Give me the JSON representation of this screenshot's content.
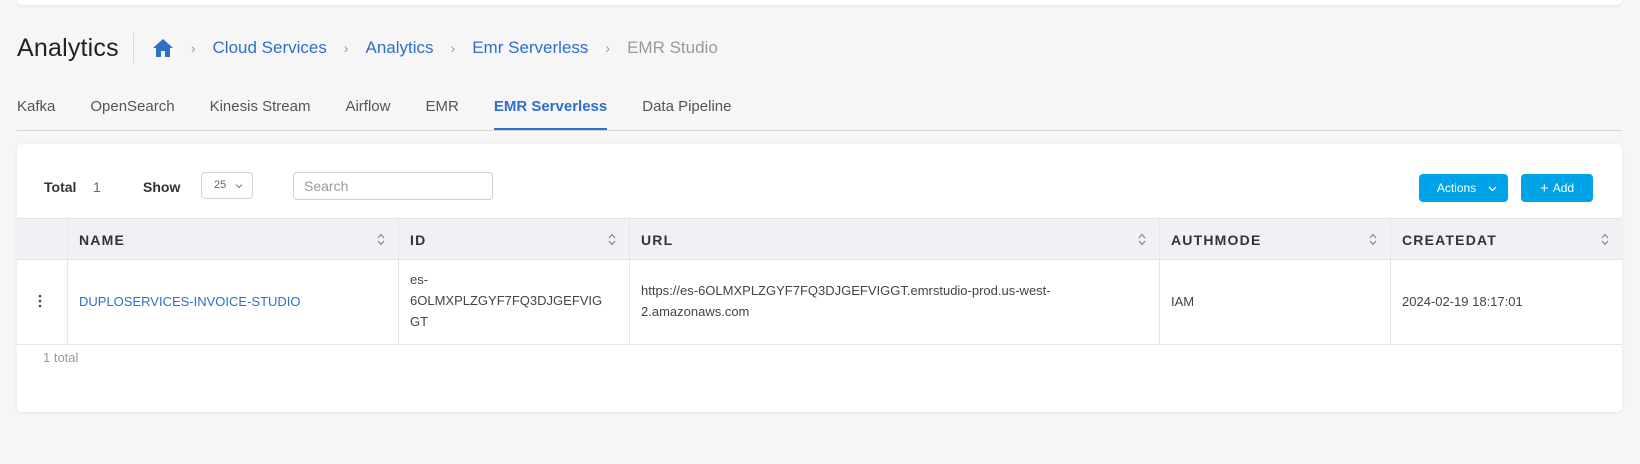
{
  "page": {
    "title": "Analytics"
  },
  "breadcrumb": {
    "items": [
      "Cloud Services",
      "Analytics",
      "Emr Serverless"
    ],
    "current": "EMR Studio"
  },
  "tabs": [
    {
      "label": "Kafka",
      "active": false
    },
    {
      "label": "OpenSearch",
      "active": false
    },
    {
      "label": "Kinesis Stream",
      "active": false
    },
    {
      "label": "Airflow",
      "active": false
    },
    {
      "label": "EMR",
      "active": false
    },
    {
      "label": "EMR Serverless",
      "active": true
    },
    {
      "label": "Data Pipeline",
      "active": false
    }
  ],
  "toolbar": {
    "total_label": "Total",
    "total_value": "1",
    "show_label": "Show",
    "page_size": "25",
    "search_placeholder": "Search",
    "search_value": "",
    "actions_label": "Actions",
    "add_label": "Add"
  },
  "table": {
    "columns": [
      "NAME",
      "ID",
      "URL",
      "AUTHMODE",
      "CREATEDAT"
    ],
    "rows": [
      {
        "name": "DUPLOSERVICES-INVOICE-STUDIO",
        "id_lines": [
          "es-",
          "6OLMXPLZGYF7FQ3DJGEFVIG",
          "GT"
        ],
        "url_lines": [
          "https://es-6OLMXPLZGYF7FQ3DJGEFVIGGT.emrstudio-prod.us-west-",
          "2.amazonaws.com"
        ],
        "authmode": "IAM",
        "createdat": "2024-02-19 18:17:01"
      }
    ],
    "footer": "1 total"
  },
  "colors": {
    "accent": "#2f6fc8",
    "button": "#00a3e8",
    "background": "#f6f6f7"
  },
  "icons": {
    "home": "home-icon",
    "breadcrumb_separator": "chevron-right-icon",
    "sort": "sort-icon",
    "row_menu": "kebab-icon",
    "dropdown": "chevron-down-icon"
  }
}
